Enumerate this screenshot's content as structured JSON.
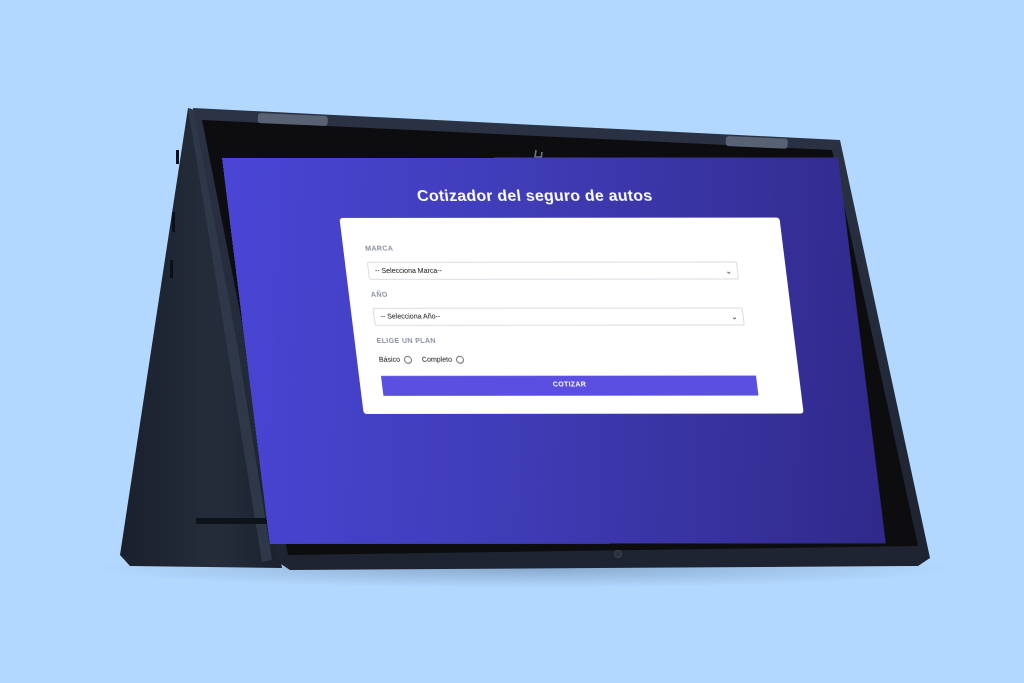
{
  "app": {
    "title": "Cotizador del seguro de autos"
  },
  "form": {
    "marca": {
      "label": "MARCA",
      "selected": "-- Selecciona Marca--"
    },
    "anio": {
      "label": "AÑO",
      "selected": "-- Selecciona Año--"
    },
    "plan": {
      "label": "ELIGE UN PLAN",
      "options": [
        "Básico",
        "Completo"
      ]
    },
    "submit_label": "COTIZAR"
  },
  "colors": {
    "page_background": "#b2d8ff",
    "screen_gradient_start": "#4a45d6",
    "screen_gradient_end": "#30298a",
    "button": "#5a4fe0",
    "device_body": "#1c2230"
  },
  "device": {
    "logo_icon": "hp-logo-icon"
  }
}
